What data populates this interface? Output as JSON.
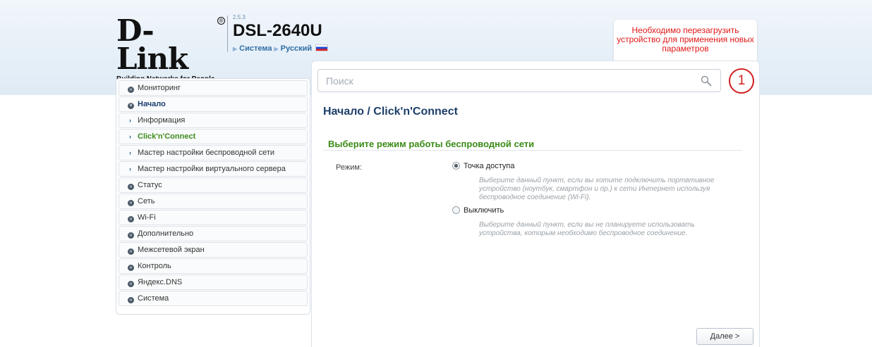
{
  "header": {
    "logo_text": "D-Link",
    "logo_reg": "®",
    "logo_tagline": "Building Networks for People",
    "firmware_version": "2.5.3",
    "model": "DSL-2640U",
    "breadcrumb": [
      "Система",
      "Русский"
    ],
    "reboot_notice": "Необходимо перезагрузить устройство для применения новых параметров",
    "reboot_count": "1"
  },
  "search": {
    "placeholder": "Поиск",
    "value": ""
  },
  "sidebar": {
    "items": [
      {
        "label": "Мониторинг",
        "icon": "chevron-circle-right-icon"
      },
      {
        "label": "Начало",
        "icon": "chevron-circle-down-icon",
        "active": true
      },
      {
        "label": "Информация",
        "sub": true
      },
      {
        "label": "Click'n'Connect",
        "sub": true,
        "current": true
      },
      {
        "label": "Мастер настройки беспроводной сети",
        "sub": true
      },
      {
        "label": "Мастер настройки виртуального сервера",
        "sub": true
      },
      {
        "label": "Статус",
        "icon": "chevron-circle-right-icon"
      },
      {
        "label": "Сеть",
        "icon": "chevron-circle-right-icon"
      },
      {
        "label": "Wi-Fi",
        "icon": "chevron-circle-right-icon"
      },
      {
        "label": "Дополнительно",
        "icon": "chevron-circle-right-icon"
      },
      {
        "label": "Межсетевой экран",
        "icon": "chevron-circle-right-icon"
      },
      {
        "label": "Контроль",
        "icon": "chevron-circle-right-icon"
      },
      {
        "label": "Яндекс.DNS",
        "icon": "chevron-circle-right-icon"
      },
      {
        "label": "Система",
        "icon": "chevron-circle-right-icon"
      }
    ]
  },
  "main": {
    "title": "Начало /  Click'n'Connect",
    "section_title": "Выберите режим работы беспроводной сети",
    "mode_label": "Режим:",
    "options": [
      {
        "label": "Точка доступа",
        "selected": true,
        "hint": "Выберите данный пункт, если вы хотите подключить портативное устройство (ноутбук, смартфон и пр.) к сети Интернет используя беспроводное соединение (Wi-Fi)."
      },
      {
        "label": "Выключить",
        "selected": false,
        "hint": "Выберите данный пункт, если вы не планируете использовать устройства, которым необходимо беспроводное соединение."
      }
    ],
    "next_label": "Далее >"
  },
  "colors": {
    "accent_green": "#3b8b18",
    "title_blue": "#1d3f6a",
    "notice_red": "#e01818"
  }
}
